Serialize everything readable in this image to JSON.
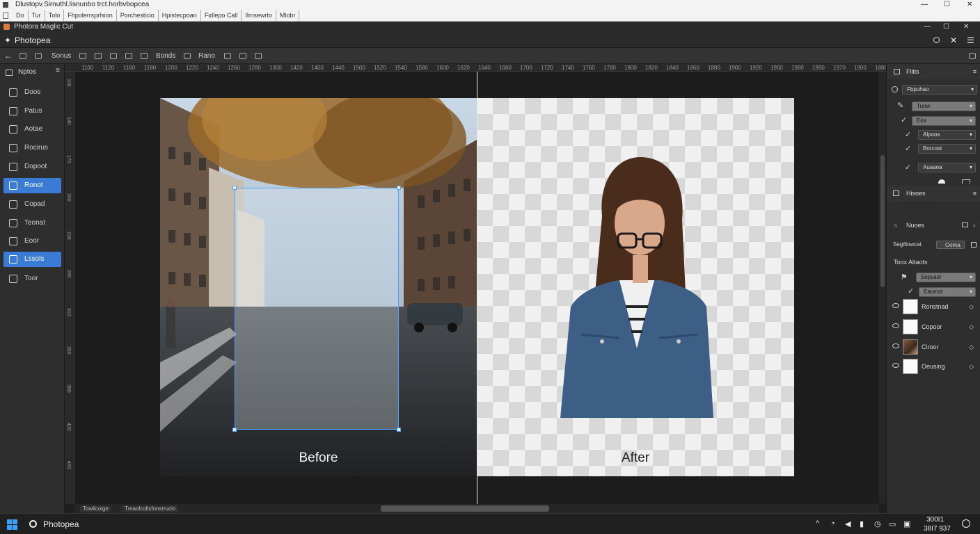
{
  "os": {
    "title": "Dlustopv.Sirnuthl.lisnunbo trct.horbvbopcea",
    "menu": [
      "Do",
      "Tur",
      "Tolo",
      "Fhpolerrsprlsion",
      "Porchesticio",
      "Hpistecpoan",
      "Fidlepo Call",
      "Ilmsewrto",
      "Mlobr"
    ],
    "controls": {
      "minimize": "—",
      "maximize": "☐",
      "close": "✕"
    }
  },
  "app": {
    "window_title": "Photora Maglic Cut",
    "name": "Photopea",
    "controls": {
      "minimize": "—",
      "maximize": "☐",
      "close": "✕"
    },
    "header_icons": [
      "search-icon",
      "close-icon",
      "menu-icon"
    ]
  },
  "toolbar": {
    "back": "←",
    "items": [
      "Sonus",
      "Bonds",
      "Rano"
    ]
  },
  "left_panel": {
    "title": "Nptos",
    "items": [
      {
        "label": "Doos",
        "active": false
      },
      {
        "label": "Patus",
        "active": false
      },
      {
        "label": "Aotae",
        "active": false
      },
      {
        "label": "Rocirus",
        "active": false
      },
      {
        "label": "Dopoot",
        "active": false
      },
      {
        "label": "Ronot",
        "active": true
      },
      {
        "label": "Copad",
        "active": false
      },
      {
        "label": "Teonat",
        "active": false
      },
      {
        "label": "Eoor",
        "active": false
      },
      {
        "label": "Lssols",
        "active": true
      },
      {
        "label": "Toor",
        "active": false
      }
    ]
  },
  "ruler_top_ticks": [
    "1100",
    "1120",
    "1160",
    "1180",
    "1200",
    "1220",
    "1240",
    "1260",
    "1280",
    "1300",
    "1420",
    "1400",
    "1440",
    "1500",
    "1520",
    "1540",
    "1580",
    "1600",
    "1620",
    "1640",
    "1680",
    "1700",
    "1720",
    "1740",
    "1760",
    "1780",
    "1800",
    "1820",
    "1840",
    "1860",
    "1880",
    "1900",
    "1920",
    "1950",
    "1980",
    "1990",
    "1970",
    "1900",
    "1880"
  ],
  "ruler_left_ticks": [
    "100",
    "140",
    "170",
    "200",
    "220",
    "280",
    "310",
    "350",
    "380",
    "420",
    "460"
  ],
  "canvas": {
    "before_label": "Before",
    "after_label": "After",
    "tags": [
      "Towlicoige",
      "Tmaolcolisfonsrrucio"
    ]
  },
  "right_panel": {
    "title": "Flitis",
    "dropdowns": [
      {
        "label": "Fbpuhao",
        "style": "dark"
      },
      {
        "label": "Tuow",
        "style": "light"
      },
      {
        "label": "Eior",
        "style": "light"
      },
      {
        "label": "Alpoos",
        "style": "dark"
      },
      {
        "label": "Borcost",
        "style": "dark"
      },
      {
        "label": "Auaaoa",
        "style": "dark"
      }
    ],
    "section_hisoes": "Hisoes",
    "section_nuos": "Nuoes",
    "segment_label": "Segifiowcat",
    "segment_button": "Ooma",
    "tools_label": "Toox Altaots",
    "tool_dropdowns": [
      {
        "label": "Sepyaol",
        "style": "light"
      },
      {
        "label": "Eaomst",
        "style": "light"
      }
    ],
    "layers": [
      {
        "name": "Ronstnad",
        "thumb": "white"
      },
      {
        "name": "Copoor",
        "thumb": "white"
      },
      {
        "name": "Ciroor",
        "thumb": "photo"
      },
      {
        "name": "Oeusing",
        "thumb": "white"
      }
    ]
  },
  "taskbar": {
    "app_label": "Photopea",
    "time": "300I1",
    "date": "38I7 937",
    "tray_icons": [
      "chevron-up-icon",
      "wifi-icon",
      "volume-icon",
      "battery-icon",
      "clock-icon",
      "chat-icon",
      "display-icon",
      "notification-icon"
    ]
  }
}
